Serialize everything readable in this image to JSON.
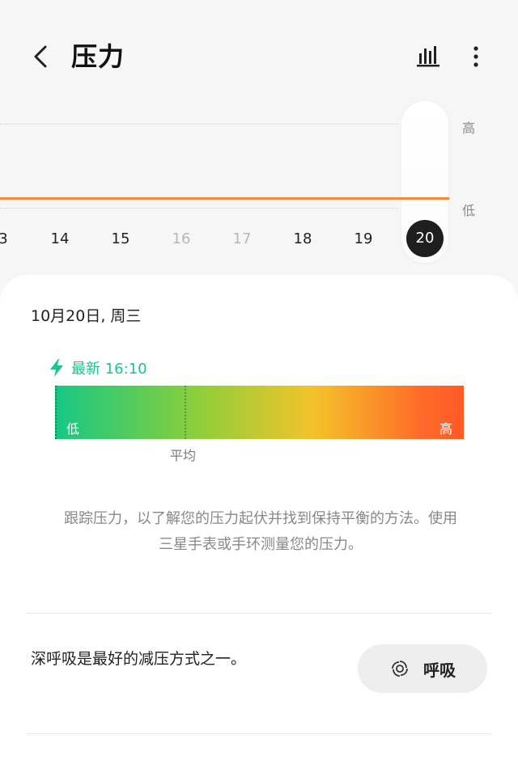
{
  "header": {
    "title": "压力"
  },
  "chart": {
    "y_labels": [
      "高",
      "低"
    ],
    "days": [
      {
        "label": "3"
      },
      {
        "label": "14"
      },
      {
        "label": "15"
      },
      {
        "label": "16"
      },
      {
        "label": "17"
      },
      {
        "label": "18"
      },
      {
        "label": "19"
      },
      {
        "label": "20"
      }
    ]
  },
  "card": {
    "date": "10月20日, 周三",
    "latest": "最新 16:10",
    "bar_low": "低",
    "bar_high": "高",
    "avg_label": "平均",
    "description": "跟踪压力，以了解您的压力起伏并找到保持平衡的方法。使用三星手表或手环测量您的压力。",
    "tip": "深呼吸是最好的减压方式之一。",
    "breath_button": "呼吸"
  },
  "colors": {
    "trend": "#f28c3b",
    "accent_green": "#20c48a",
    "selected_day": "#1e1e1e"
  },
  "icons": {
    "back": "chevron-left-icon",
    "chart": "bar-chart-icon",
    "more": "more-vertical-icon",
    "latest": "lightning-icon",
    "breath": "breath-swirl-icon"
  }
}
